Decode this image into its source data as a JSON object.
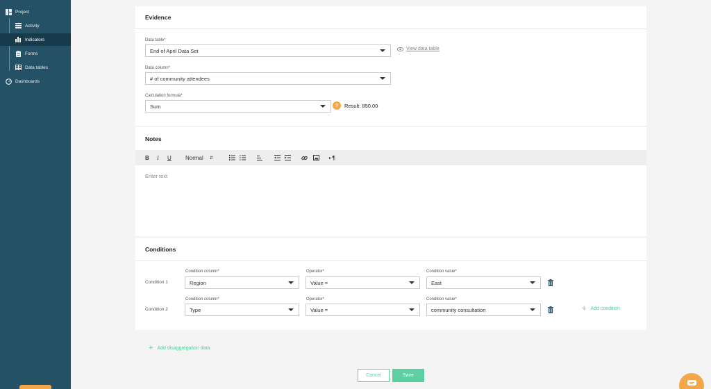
{
  "sidebar": {
    "project": "Project",
    "items": [
      {
        "label": "Activity",
        "icon": "list-icon"
      },
      {
        "label": "Indicators",
        "icon": "bar-chart-icon",
        "active": true
      },
      {
        "label": "Forms",
        "icon": "clipboard-icon"
      },
      {
        "label": "Data tables",
        "icon": "table-icon"
      }
    ],
    "dashboards": "Dashboards"
  },
  "evidence": {
    "title": "Evidence",
    "data_table_label": "Data table*",
    "data_table_value": "End of April Data Set",
    "view_data_table": "View data table",
    "data_column_label": "Data column*",
    "data_column_value": "# of community attendees",
    "formula_label": "Calculation formula*",
    "formula_value": "Sum",
    "help_icon": "?",
    "result": "Result: 850.00"
  },
  "notes": {
    "title": "Notes",
    "toolbar": {
      "bold": "B",
      "italic": "I",
      "underline": "U",
      "style": "Normal"
    },
    "placeholder": "Enter text"
  },
  "conditions": {
    "title": "Conditions",
    "rows": [
      {
        "label": "Condition 1",
        "column_label": "Condition column*",
        "column_value": "Region",
        "operator_label": "Operator*",
        "operator_value": "Value =",
        "value_label": "Condition value*",
        "value_value": "East"
      },
      {
        "label": "Condition 2",
        "column_label": "Condition column*",
        "column_value": "Type",
        "operator_label": "Operator*",
        "operator_value": "Value =",
        "value_label": "Condition value*",
        "value_value": "community consultation"
      }
    ],
    "add_condition": "Add condition"
  },
  "add_disaggregation": "Add disaggregation data",
  "buttons": {
    "cancel": "Cancel",
    "save": "Save"
  },
  "colors": {
    "sidebar": "#245166",
    "sidebar_active": "#173b4b",
    "accent_green": "#5dcfa3",
    "accent_orange": "#f3a64a"
  }
}
